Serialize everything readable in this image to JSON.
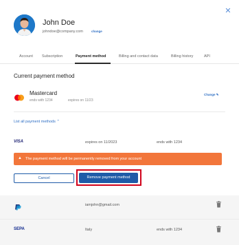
{
  "user": {
    "name": "John Doe",
    "email": "johndoe@company.com",
    "change_label": "change"
  },
  "tabs": [
    {
      "label": "Account"
    },
    {
      "label": "Subscription"
    },
    {
      "label": "Payment method",
      "active": true
    },
    {
      "label": "Billing and contact data"
    },
    {
      "label": "Billing history"
    },
    {
      "label": "API"
    }
  ],
  "current_payment": {
    "section_title": "Current payment method",
    "brand": "Mastercard",
    "ends_with": "ends with 1234",
    "expires": "expires on 11/23",
    "change_label": "Change"
  },
  "list_toggle_label": "List all payment methods",
  "methods": [
    {
      "logo": "VISA",
      "expires": "expires on 11/2023",
      "ends_with": "ends with 1234"
    },
    {
      "logo": "paypal-icon",
      "email": "iamjohn@gmail.com"
    },
    {
      "logo": "SEPA",
      "country": "Italy",
      "ends_with": "ends with 1234"
    }
  ],
  "warning": {
    "text": "The payment method will be permanently removed from your account",
    "color": "#f2763b"
  },
  "buttons": {
    "cancel": "Cancel",
    "remove": "Remove payment method"
  },
  "colors": {
    "primary": "#1e5ba8",
    "link": "#2f6fc4",
    "highlight": "#d0021b"
  }
}
